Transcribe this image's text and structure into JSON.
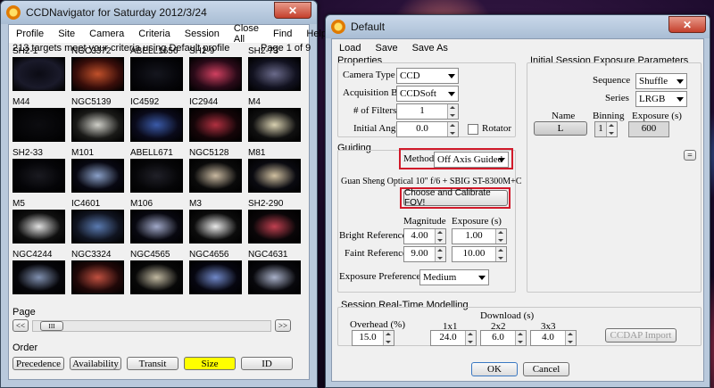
{
  "navigator": {
    "title": "CCDNavigator for Saturday 2012/3/24",
    "menu": [
      "Profile",
      "Site",
      "Camera",
      "Criteria",
      "Session",
      "Close All",
      "Find",
      "Help"
    ],
    "status": "213 targets meet your criteria using Default profile",
    "page_info": "Page 1 of 9",
    "targets": [
      {
        "name": "SH2-1",
        "colors": [
          "#0b0b14",
          "#1a1a2a"
        ]
      },
      {
        "name": "NGC3372",
        "colors": [
          "#c0502a",
          "#3a0e0a"
        ]
      },
      {
        "name": "ABELL1656",
        "colors": [
          "#15161e",
          "#06060a"
        ]
      },
      {
        "name": "SH2-9",
        "colors": [
          "#d04060",
          "#2a0a18"
        ]
      },
      {
        "name": "SH2-73",
        "colors": [
          "#6a6a8a",
          "#121220"
        ]
      },
      {
        "name": "M44",
        "colors": [
          "#0c0c10",
          "#050507"
        ]
      },
      {
        "name": "NGC5139",
        "colors": [
          "#cfcfc8",
          "#1a1a18"
        ]
      },
      {
        "name": "IC4592",
        "colors": [
          "#3a5aa8",
          "#0a0a1a"
        ]
      },
      {
        "name": "IC2944",
        "colors": [
          "#b03040",
          "#150508"
        ]
      },
      {
        "name": "M4",
        "colors": [
          "#d8d0b0",
          "#101010"
        ]
      },
      {
        "name": "SH2-33",
        "colors": [
          "#1a1a20",
          "#050508"
        ]
      },
      {
        "name": "M101",
        "colors": [
          "#8aa0c8",
          "#080812"
        ]
      },
      {
        "name": "ABELL671",
        "colors": [
          "#202028",
          "#060608"
        ]
      },
      {
        "name": "NGC5128",
        "colors": [
          "#c8b8a0",
          "#0a0a0a"
        ]
      },
      {
        "name": "M81",
        "colors": [
          "#d0c0a0",
          "#0a0a10"
        ]
      },
      {
        "name": "M5",
        "colors": [
          "#e0e0e0",
          "#101010"
        ]
      },
      {
        "name": "IC4601",
        "colors": [
          "#5a7ab0",
          "#101420"
        ]
      },
      {
        "name": "M106",
        "colors": [
          "#a0a8c8",
          "#080810"
        ]
      },
      {
        "name": "M3",
        "colors": [
          "#e8e8e8",
          "#0c0c0c"
        ]
      },
      {
        "name": "SH2-290",
        "colors": [
          "#c04050",
          "#0a0608"
        ]
      },
      {
        "name": "NGC4244",
        "colors": [
          "#8090b0",
          "#06060a"
        ]
      },
      {
        "name": "NGC3324",
        "colors": [
          "#c05040",
          "#200808"
        ]
      },
      {
        "name": "NGC4565",
        "colors": [
          "#c0b8a0",
          "#080808"
        ]
      },
      {
        "name": "NGC4656",
        "colors": [
          "#7088c8",
          "#060610"
        ]
      },
      {
        "name": "NGC4631",
        "colors": [
          "#a8b0c8",
          "#08080c"
        ]
      }
    ],
    "page_label": "Page",
    "scroll_left": "<<",
    "scroll_right": ">>",
    "scroll_thumb": "III",
    "order_label": "Order",
    "order_buttons": [
      {
        "label": "Precedence",
        "active": false
      },
      {
        "label": "Availability",
        "active": false
      },
      {
        "label": "Transit",
        "active": false
      },
      {
        "label": "Size",
        "active": true
      },
      {
        "label": "ID",
        "active": false
      }
    ],
    "active_color": "#ffff00"
  },
  "dialog": {
    "title": "Default",
    "menu": [
      "Load",
      "Save",
      "Save As"
    ],
    "properties": {
      "legend": "Properties",
      "camera_type_label": "Camera Type",
      "camera_type_value": "CCD",
      "acquisition_label": "Acquisition By",
      "acquisition_value": "CCDSoft",
      "filters_label": "# of Filters",
      "filters_value": "1",
      "angle_label": "Initial Angle",
      "angle_value": "0.0",
      "rotator_label": "Rotator"
    },
    "guiding": {
      "legend": "Guiding",
      "method_label": "Method",
      "method_value": "Off Axis Guided",
      "optics": "Guan Sheng Optical 10\" f/6 + SBIG ST-8300M+C",
      "calibrate_button": "Choose and Calibrate FOV!",
      "magnitude_header": "Magnitude",
      "exposure_header": "Exposure (s)",
      "bright_label": "Bright Reference",
      "bright_mag": "4.00",
      "bright_exp": "1.00",
      "faint_label": "Faint Reference",
      "faint_mag": "9.00",
      "faint_exp": "10.00",
      "pref_label": "Exposure Preference",
      "pref_value": "Medium"
    },
    "exposure_params": {
      "legend": "Initial Session Exposure Parameters",
      "sequence_label": "Sequence",
      "sequence_value": "Shuffle",
      "series_label": "Series",
      "series_value": "LRGB",
      "name_header": "Name",
      "binning_header": "Binning",
      "exposure_header": "Exposure (s)",
      "filter_name": "L",
      "binning_value": "1",
      "exposure_value": "600",
      "equals_button": "="
    },
    "modelling": {
      "legend": "Session Real-Time Modelling",
      "overhead_label": "Overhead (%)",
      "overhead_value": "15.0",
      "download_label": "Download (s)",
      "d1_label": "1x1",
      "d1_value": "24.0",
      "d2_label": "2x2",
      "d2_value": "6.0",
      "d3_label": "3x3",
      "d3_value": "4.0",
      "import_button": "CCDAP Import"
    },
    "ok_button": "OK",
    "cancel_button": "Cancel"
  },
  "highlight_color": "#d11a2a"
}
